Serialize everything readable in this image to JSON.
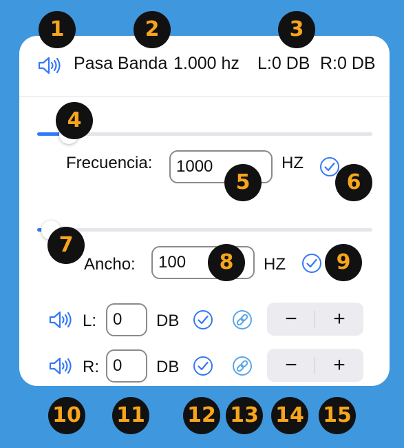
{
  "header": {
    "speaker_icon": "speaker-wave-icon",
    "filter_name": "Pasa Banda",
    "frequency": "1.000 hz",
    "left_gain": "L:0 DB",
    "right_gain": "R:0 DB"
  },
  "frequency_control": {
    "slider_level": 0.01,
    "label": "Frecuencia:",
    "value": "1000",
    "unit": "HZ",
    "confirm_icon": "checkmark-circle-icon"
  },
  "width_control": {
    "slider_level": 0.01,
    "label": "Ancho:",
    "value": "100",
    "unit": "HZ",
    "confirm_icon": "checkmark-circle-icon"
  },
  "channels": [
    {
      "speaker_icon": "speaker-wave-icon",
      "label": "L:",
      "value": "0",
      "unit": "DB",
      "confirm_icon": "checkmark-circle-icon",
      "link_icon": "link-icon",
      "minus": "−",
      "plus": "+"
    },
    {
      "speaker_icon": "speaker-wave-icon",
      "label": "R:",
      "value": "0",
      "unit": "DB",
      "confirm_icon": "checkmark-circle-icon",
      "link_icon": "link-icon",
      "minus": "−",
      "plus": "+"
    }
  ],
  "colors": {
    "background": "#3f97de",
    "accent": "#3478f6",
    "link_accent": "#5aa6e6",
    "badge_fill": "#111111",
    "badge_text": "#f7a51c"
  },
  "badges": [
    "1",
    "2",
    "3",
    "4",
    "5",
    "6",
    "7",
    "8",
    "9",
    "10",
    "11",
    "12",
    "13",
    "14",
    "15"
  ]
}
